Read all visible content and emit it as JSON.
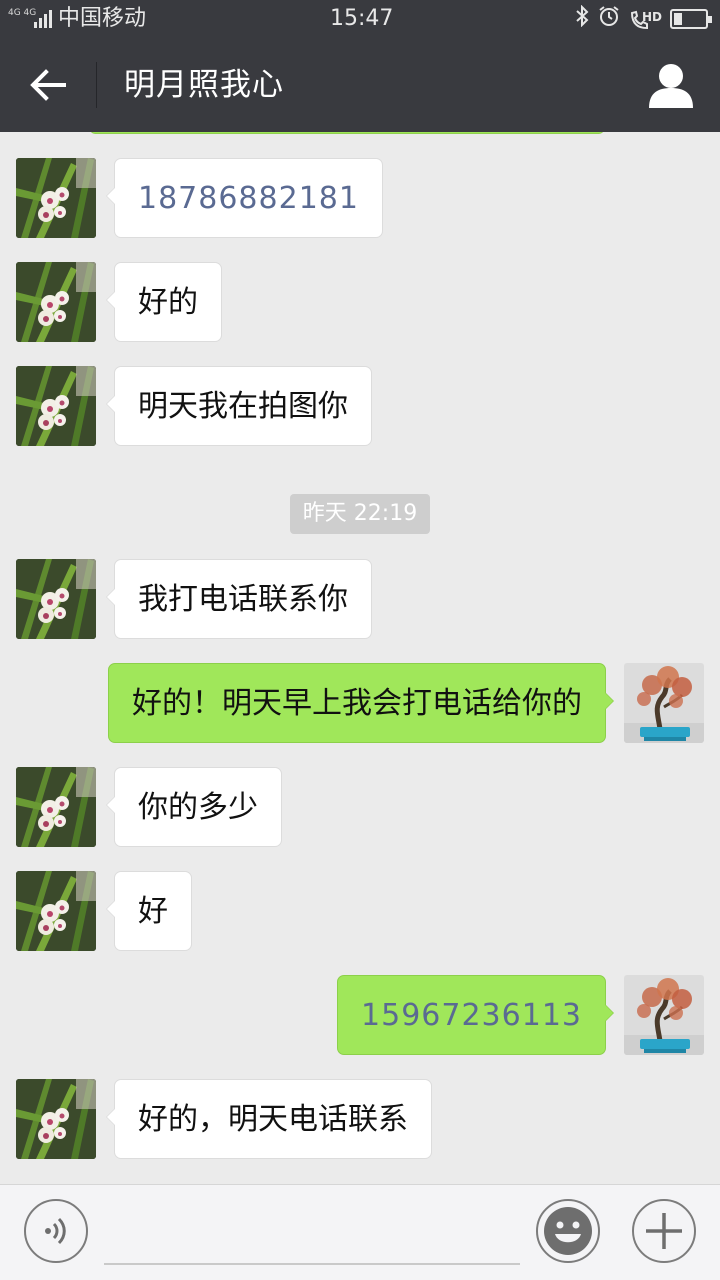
{
  "status_bar": {
    "network_tag": "4G 4G",
    "carrier": "中国移动",
    "time": "15:47",
    "icons": [
      "bluetooth-icon",
      "alarm-icon",
      "hd-call-icon",
      "battery-icon"
    ],
    "hd_label": "HD",
    "battery_level": 0.25
  },
  "header": {
    "title": "明月照我心",
    "back_icon": "arrow-left-icon",
    "profile_icon": "person-icon"
  },
  "messages": [
    {
      "side": "left",
      "text": "18786882181",
      "is_link": true
    },
    {
      "side": "left",
      "text": "好的"
    },
    {
      "side": "left",
      "text": "明天我在拍图你"
    },
    {
      "type": "timestamp",
      "text": "昨天 22:19"
    },
    {
      "side": "left",
      "text": "我打电话联系你"
    },
    {
      "side": "right",
      "text": "好的！明天早上我会打电话给你的"
    },
    {
      "side": "left",
      "text": "你的多少"
    },
    {
      "side": "left",
      "text": "好"
    },
    {
      "side": "right",
      "text": "15967236113",
      "is_link": true
    },
    {
      "side": "left",
      "text": "好的，明天电话联系"
    }
  ],
  "input_bar": {
    "value": "",
    "voice_icon": "voice-icon",
    "emoji_icon": "emoji-icon",
    "plus_icon": "plus-icon"
  },
  "colors": {
    "header_bg": "#393a3f",
    "chat_bg": "#ebebeb",
    "sent_bubble": "#a0e75a",
    "received_bubble": "#ffffff",
    "link_text": "#5a6a92"
  }
}
